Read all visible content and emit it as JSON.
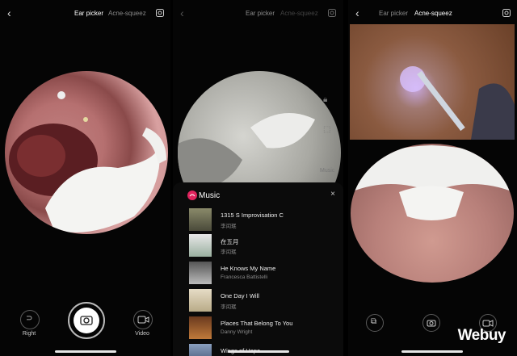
{
  "tabs": {
    "ear": "Ear picker",
    "acne": "Acne-squeez"
  },
  "icons": {
    "back": "chevron-left-icon",
    "settings": "gear-icon",
    "camera": "camera-icon",
    "video": "video-icon",
    "ear": "ear-icon",
    "music": "music-icon"
  },
  "panel1": {
    "right_label": "Right",
    "video_label": "Video"
  },
  "panel2": {
    "side_labels": [
      "k",
      "Music"
    ]
  },
  "music": {
    "title": "Music",
    "close": "×",
    "tracks": [
      {
        "name": "1315 S Improvisation C",
        "artist": "李闰珉"
      },
      {
        "name": "在五月",
        "artist": "李闰珉"
      },
      {
        "name": "He Knows My Name",
        "artist": "Francesca Battistelli"
      },
      {
        "name": "One Day I Will",
        "artist": "李闰珉"
      },
      {
        "name": "Places That Belong To You",
        "artist": "Danny Wright"
      },
      {
        "name": "Wings of Hope",
        "artist": ""
      }
    ]
  },
  "watermark": "Webuy",
  "colors": {
    "accent_music": "#e0245e",
    "background": "#000000"
  }
}
